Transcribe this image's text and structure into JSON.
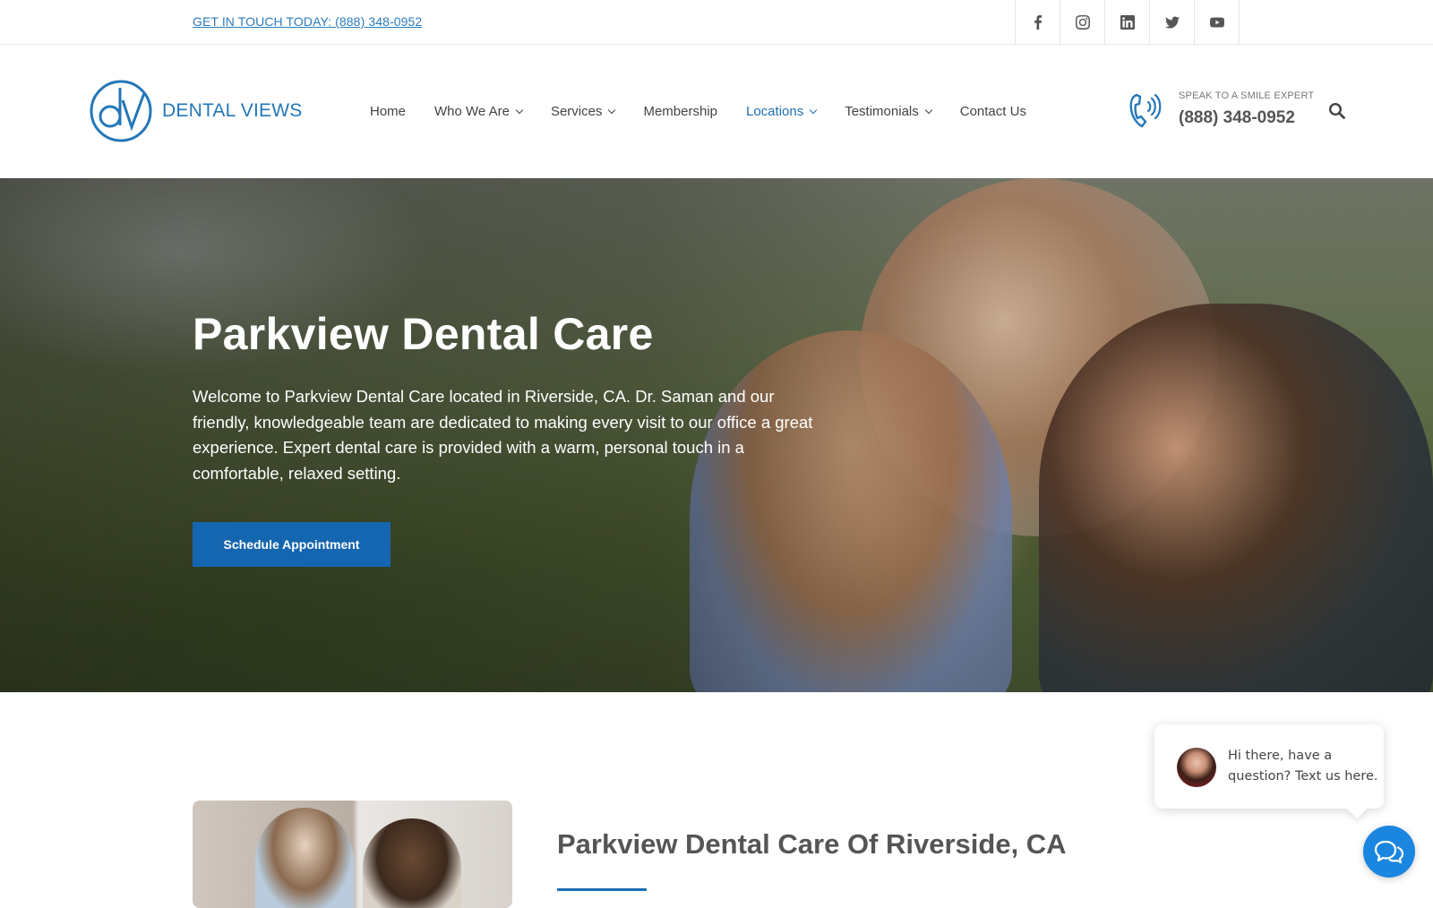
{
  "topbar": {
    "contact_link": "GET IN TOUCH TODAY: (888) 348-0952",
    "socials": [
      "facebook-icon",
      "instagram-icon",
      "linkedin-icon",
      "twitter-icon",
      "youtube-icon"
    ]
  },
  "header": {
    "logo_text": "DENTAL VIEWS",
    "nav": [
      {
        "label": "Home"
      },
      {
        "label": "Who We Are"
      },
      {
        "label": "Services"
      },
      {
        "label": "Membership"
      },
      {
        "label": "Locations"
      },
      {
        "label": "Testimonials"
      },
      {
        "label": "Contact Us"
      }
    ],
    "phone_caption": "SPEAK TO A SMILE EXPERT",
    "phone_number": "(888) 348-0952"
  },
  "hero": {
    "title": "Parkview Dental Care",
    "description": "Welcome to Parkview Dental Care located in Riverside, CA. Dr. Saman and our friendly, knowledgeable team are dedicated to making every visit to our office a great experience. Expert dental care is provided with a warm, personal touch in a comfortable, relaxed setting.",
    "cta": "Schedule Appointment"
  },
  "section": {
    "title": "Parkview Dental Care Of Riverside, CA"
  },
  "chat": {
    "message": "Hi there, have a question? Text us here."
  },
  "colors": {
    "accent": "#1566b0",
    "link": "#2b7bbf",
    "chat": "#1b86e0"
  }
}
